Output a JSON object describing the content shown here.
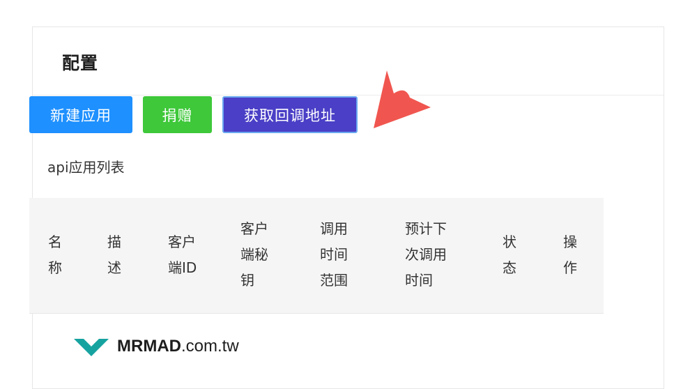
{
  "card": {
    "title": "配置"
  },
  "toolbar": {
    "new_app_label": "新建应用",
    "donate_label": "捐赠",
    "get_callback_label": "获取回调地址"
  },
  "list": {
    "caption": "api应用列表",
    "columns": [
      "名\n称",
      "描\n述",
      "客户\n端ID",
      "客户\n端秘\n钥",
      "调用\n时间\n范围",
      "预计下\n次调用\n时间",
      "状\n态",
      "操\n作"
    ]
  },
  "annotation": {
    "arrow_color": "#f0564f"
  },
  "watermark": {
    "brand": "MRMAD",
    "domain": ".com.tw",
    "logo_color": "#16a3a0"
  }
}
